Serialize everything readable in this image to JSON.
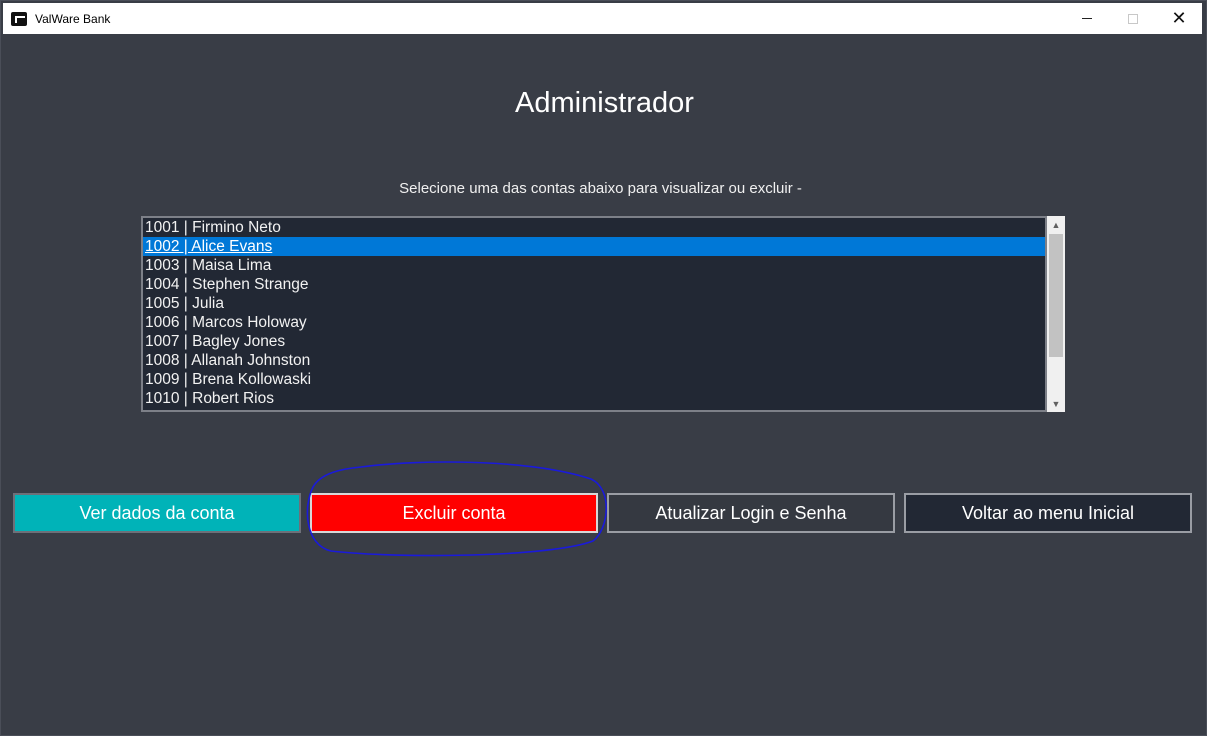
{
  "window": {
    "title": "ValWare Bank"
  },
  "page": {
    "heading": "Administrador",
    "subtitle": "Selecione uma das contas abaixo para visualizar ou excluir -"
  },
  "accounts": {
    "items": [
      "1001 | Firmino Neto",
      "1002 | Alice Evans",
      "1003 | Maisa Lima",
      "1004 | Stephen Strange",
      "1005 | Julia",
      "1006 | Marcos Holoway",
      "1007 | Bagley Jones",
      "1008 | Allanah Johnston",
      "1009 | Brena Kollowaski",
      "1010 | Robert Rios"
    ],
    "selected_index": 1
  },
  "buttons": {
    "view_label": "Ver dados da conta",
    "delete_label": "Excluir conta",
    "update_label": "Atualizar Login e Senha",
    "back_label": "Voltar ao menu Inicial"
  },
  "colors": {
    "background": "#393d46",
    "list_bg": "#222834",
    "selection": "#0078d7",
    "view_button": "#00b3b8",
    "delete_button": "#ff0000",
    "annotation_circle": "#1a1adb"
  },
  "icons": {
    "app": "valware-app-icon",
    "minimize": "minimize-icon",
    "maximize": "maximize-icon",
    "close": "close-icon",
    "scroll_up": "chevron-up-icon",
    "scroll_down": "chevron-down-icon"
  }
}
